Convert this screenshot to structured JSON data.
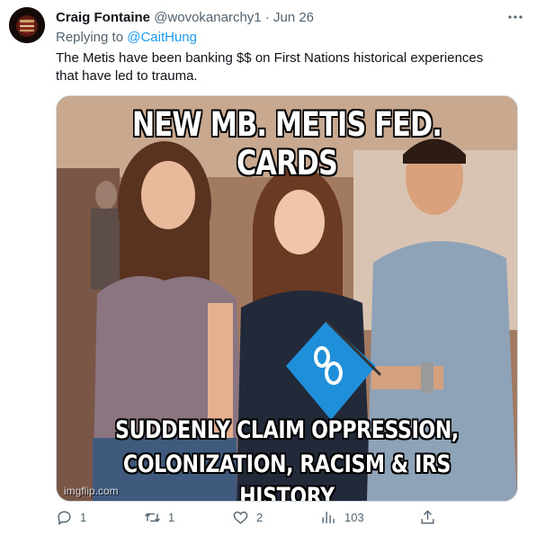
{
  "author": {
    "name": "Craig Fontaine",
    "handle": "@wovokanarchy1",
    "separator": "·",
    "date": "Jun 26"
  },
  "replying_to": {
    "prefix": "Replying to ",
    "user": "@CaitHung"
  },
  "tweet_text": "The Metis have been banking $$ on First Nations historical experiences that have led to trauma.",
  "media": {
    "top_text": "NEW MB. METIS FED. CARDS",
    "bottom_line1": "SUDDENLY CLAIM OPPRESSION,",
    "bottom_line2": "COLONIZATION, RACISM & IRS HISTORY",
    "watermark": "imgflip.com"
  },
  "actions": {
    "replies": "1",
    "retweets": "1",
    "likes": "2",
    "views": "103"
  },
  "colors": {
    "link": "#1d9bf0",
    "muted": "#536471",
    "text": "#0f1419",
    "flag": "#1e8fd8"
  },
  "icons": [
    "more-icon",
    "reply-icon",
    "retweet-icon",
    "like-icon",
    "views-icon",
    "share-icon"
  ]
}
